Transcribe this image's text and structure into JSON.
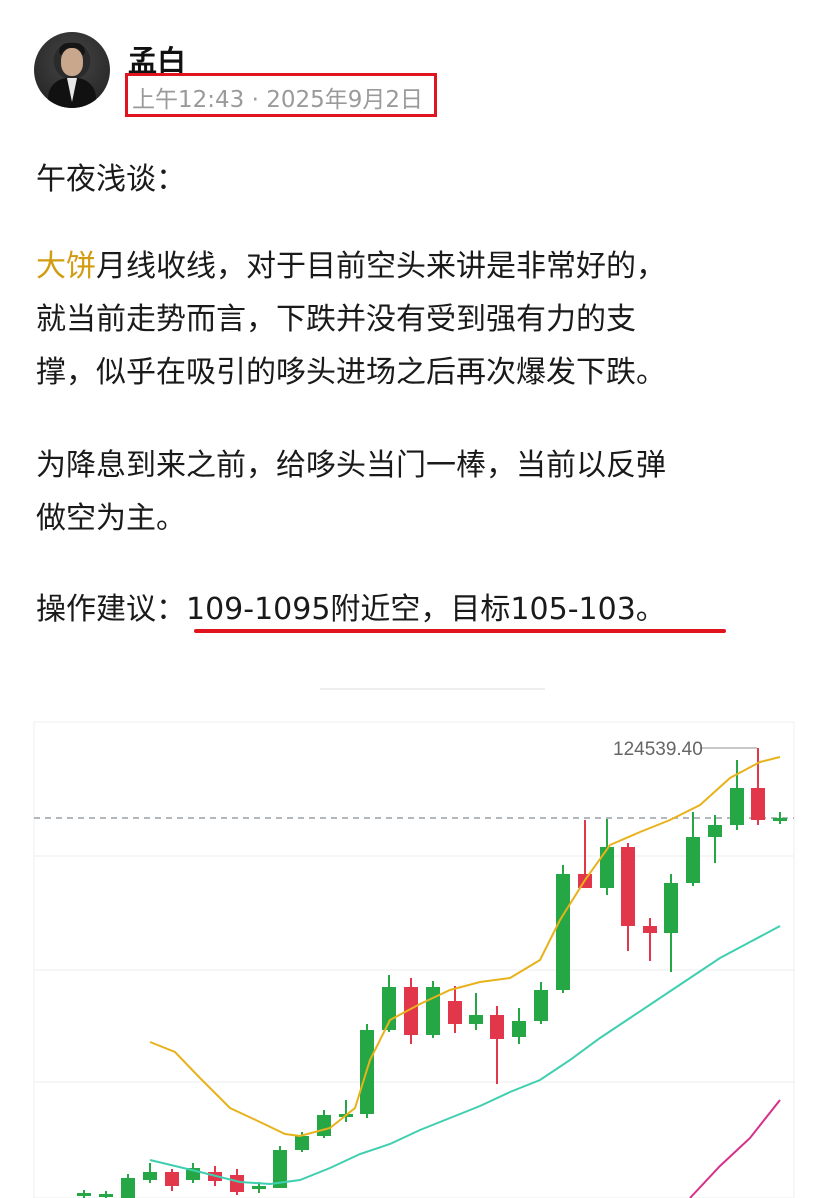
{
  "post": {
    "author": "孟白",
    "time": "上午12:43",
    "separator": " · ",
    "date": "2025年9月2日",
    "lines": [
      "午夜浅谈：",
      "月线收线，对于目前空头来讲是非常好的，",
      "就当前走势而言，下跌并没有受到强有力的支",
      "撑，似乎在吸引的哆头进场之后再次爆发下跌。",
      "为降息到来之前，给哆头当门一棒，当前以反弹",
      "做空为主。",
      "操作建议：109-1095附近空，目标105-103。"
    ],
    "highlight_word": "大饼"
  },
  "chart": {
    "price_label": "124539.40",
    "colors": {
      "up": "#25a745",
      "down": "#e2374a",
      "ma_short": "#e8b21c",
      "ma_mid": "#3fcfb0",
      "ma_long": "#d6308a",
      "grid": "#e9e9e9",
      "dashed": "#9aa0a6"
    }
  },
  "chart_data": {
    "type": "candlestick",
    "price_high_label": "124539.40",
    "note": "candlestick chart with moving averages; no axes or values are printed besides the high price"
  }
}
